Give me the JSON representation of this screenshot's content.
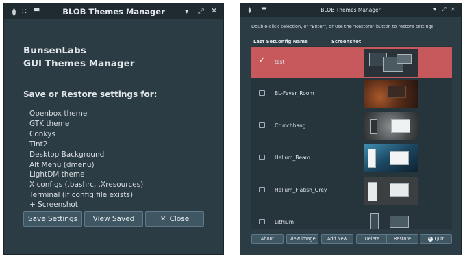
{
  "left_window": {
    "title": "BLOB Themes Manager",
    "heading_line1": "BunsenLabs",
    "heading_line2": "GUI Themes Manager",
    "subheading": "Save or Restore settings for:",
    "items": [
      "Openbox theme",
      "GTK theme",
      "Conkys",
      "Tint2",
      "Desktop Background",
      "Alt Menu (dmenu)",
      "LightDM theme",
      "X configs (.bashrc, .Xresources)",
      "Terminal (if config file exists)",
      "+ Screenshot"
    ],
    "buttons": {
      "save": "Save Settings",
      "view": "View Saved",
      "close": "Close"
    }
  },
  "right_window": {
    "title": "BLOB Themes Manager",
    "hint": "Double-click selection, or \"Enter\", or use the \"Restore\" button to restore settings",
    "columns": [
      "Last Set",
      "Config Name",
      "Screenshot"
    ],
    "rows": [
      {
        "name": "test",
        "last_set": true
      },
      {
        "name": "BL-Fever_Room",
        "last_set": false
      },
      {
        "name": "Crunchbang",
        "last_set": false
      },
      {
        "name": "Helium_Beam",
        "last_set": false
      },
      {
        "name": "Helium_Flatish_Grey",
        "last_set": false
      },
      {
        "name": "Lithium",
        "last_set": false
      }
    ],
    "buttons": [
      "About",
      "View image",
      "Add New",
      "Delete",
      "Restore",
      "Quit"
    ]
  },
  "colors": {
    "window_bg": "#2c3c44",
    "titlebar_bg": "#1f2b31",
    "selected_row": "#c7595d",
    "button_bg": "#3f5663"
  }
}
